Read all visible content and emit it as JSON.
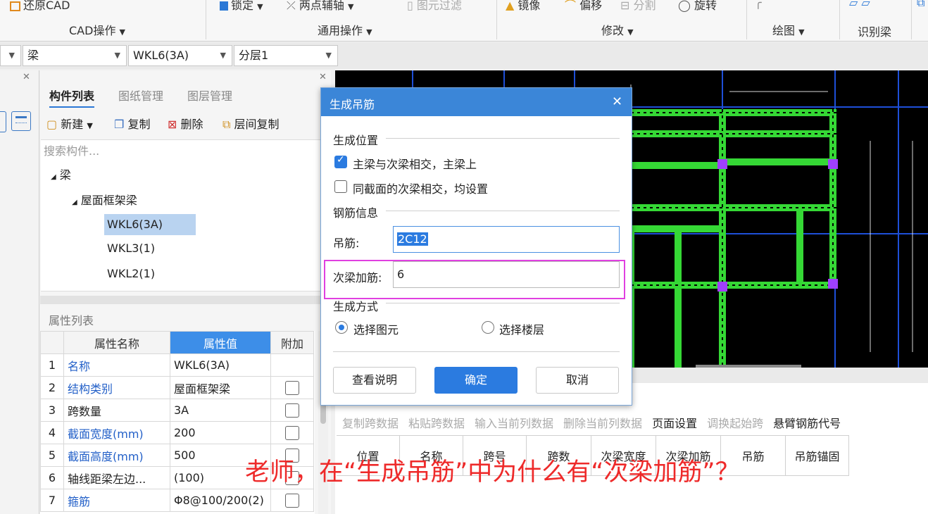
{
  "ribbon": {
    "restore_cad": "还原CAD",
    "cad_ops": "CAD操作",
    "lock": "锁定",
    "two_point_axis": "两点辅轴",
    "element_filter": "图元过滤",
    "general_ops": "通用操作",
    "mirror": "镜像",
    "offset": "偏移",
    "split": "分割",
    "rotate": "旋转",
    "modify": "修改",
    "draw": "绘图",
    "identify_beam": "识别梁"
  },
  "selectors": {
    "type": "梁",
    "component": "WKL6(3A)",
    "layer": "分层1"
  },
  "component_panel": {
    "tabs": [
      "构件列表",
      "图纸管理",
      "图层管理"
    ],
    "toolbar": {
      "new": "新建",
      "copy": "复制",
      "delete": "删除",
      "floor_copy": "层间复制"
    },
    "search_placeholder": "搜索构件...",
    "tree": {
      "root": "梁",
      "group": "屋面框架梁",
      "items": [
        "WKL6(3A)",
        "WKL3(1)",
        "WKL2(1)"
      ]
    }
  },
  "property_panel": {
    "title": "属性列表",
    "headers": {
      "name": "属性名称",
      "value": "属性值",
      "extra": "附加"
    },
    "rows": [
      {
        "no": "1",
        "name": "名称",
        "value": "WKL6(3A)"
      },
      {
        "no": "2",
        "name": "结构类别",
        "value": "屋面框架梁"
      },
      {
        "no": "3",
        "name": "跨数量",
        "value": "3A"
      },
      {
        "no": "4",
        "name": "截面宽度(mm)",
        "value": "200"
      },
      {
        "no": "5",
        "name": "截面高度(mm)",
        "value": "500"
      },
      {
        "no": "6",
        "name": "轴线距梁左边...",
        "value": "(100)"
      },
      {
        "no": "7",
        "name": "箍筋",
        "value": "Φ8@100/200(2)"
      }
    ]
  },
  "dialog": {
    "title": "生成吊筋",
    "section_position": "生成位置",
    "opt_main_secondary": "主梁与次梁相交，主梁上",
    "opt_same_section": "同截面的次梁相交，均设置",
    "section_rebar": "钢筋信息",
    "hanger_label": "吊筋:",
    "hanger_value": "2C12",
    "secondary_label": "次梁加筋:",
    "secondary_value": "6",
    "section_method": "生成方式",
    "method_select_element": "选择图元",
    "method_select_floor": "选择楼层",
    "btn_help": "查看说明",
    "btn_ok": "确定",
    "btn_cancel": "取消"
  },
  "span_toolbar": {
    "items": [
      "复制跨数据",
      "粘贴跨数据",
      "输入当前列数据",
      "删除当前列数据",
      "页面设置",
      "调换起始跨",
      "悬臂钢筋代号"
    ]
  },
  "span_table_headers": [
    "位置",
    "名称",
    "跨号",
    "跨数",
    "次梁宽度",
    "次梁加筋",
    "吊筋",
    "吊筋锚固"
  ],
  "annotation": "老师，在“生成吊筋”中为什么有“次梁加筋”？",
  "colors": {
    "accent": "#2b7be0",
    "beam": "#35d835",
    "annotation": "#ee2a2a"
  }
}
